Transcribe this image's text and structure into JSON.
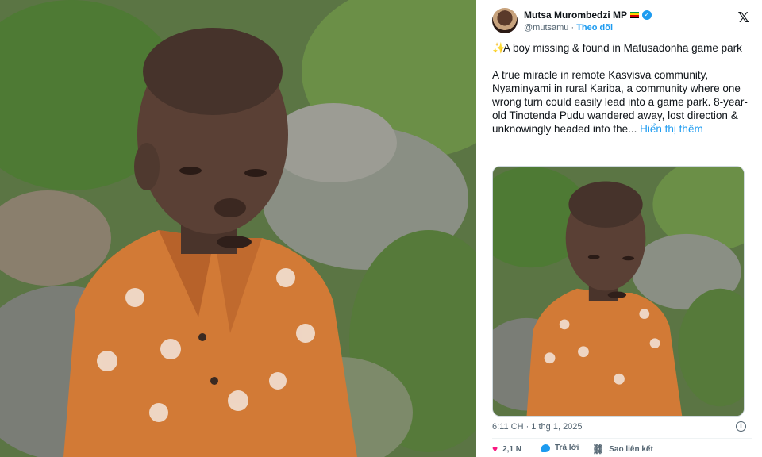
{
  "tweet": {
    "author_name": "Mutsa Murombedzi MP",
    "handle": "@mutsamu",
    "separator": "·",
    "follow_label": "Theo dõi",
    "title_line": "A boy missing & found in Matusadonha game park",
    "body": "A true miracle in remote Kasvisva community, Nyaminyami in rural Kariba, a community where one wrong turn could easily lead into a game park.  8-year-old Tinotenda Pudu wandered away, lost direction & unknowingly headed into the...",
    "show_more": "Hiển thị thêm",
    "timestamp": "6:11 CH · 1 thg 1, 2025",
    "likes": "2,1 N",
    "reply_label": "Trả lời",
    "copy_link_label": "Sao liên kết"
  },
  "icons": {
    "platform": "x-logo-icon",
    "verified": "verified-badge-icon",
    "flag": "zimbabwe-flag-icon",
    "emoji": "sparkle-star-icon",
    "info": "info-icon",
    "like": "heart-icon",
    "reply": "reply-bubble-icon",
    "link": "link-icon"
  },
  "colors": {
    "accent": "#1d9bf0",
    "like": "#f91880",
    "text": "#0f1419",
    "muted": "#536471"
  }
}
